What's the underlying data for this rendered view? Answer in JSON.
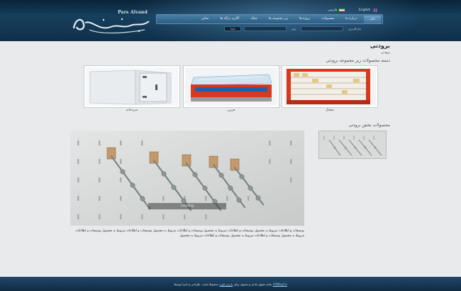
{
  "header": {
    "logo": {
      "latin_text": "Pars Alvand",
      "persian_text": "پارس الوند"
    },
    "languages": [
      {
        "label": "English",
        "flag": "uk-flag"
      },
      {
        "label": "فارسی",
        "flag": "iran-flag"
      }
    ],
    "nav": [
      {
        "label": "خانه"
      },
      {
        "label": "درباره ما"
      },
      {
        "label": "محصولات"
      },
      {
        "label": "پروژه ها"
      },
      {
        "label": "زیر مجموعه ها"
      },
      {
        "label": "مقاله"
      },
      {
        "label": "گالری درگاه ها"
      },
      {
        "label": "تماس"
      }
    ],
    "login": {
      "username_label": "نام کاربری",
      "password_label": "رمز",
      "button_label": "ورود"
    }
  },
  "main": {
    "page_title": "برودتی",
    "breadcrumb": "برودتی",
    "subcategories_heading": "دسته محصولات زیر مجموعه برودتی",
    "subcategories": [
      {
        "caption": "یخچال"
      },
      {
        "caption": "فریزر"
      },
      {
        "caption": "سردخانه"
      }
    ],
    "products_heading": "محصولات بخش برودتی",
    "loading_text": "Loading",
    "description": "توضیحات و اطلاعات مربوط به محصول توضیحات و اطلاعات مربوط به محصول توضیحات و اطلاعات مربوط به محصول توضیحات و اطلاعات مربوط به محصول توضیحات و اطلاعات مربوط به محصول توضیحات و اطلاعات مربوط به محصول توضیحات و اطلاعات مربوط به محصول"
  },
  "footer": {
    "text_before": "تمام حقوق مادی و معنوی برای",
    "company_link": "پارس الوند",
    "text_middle": "محفوظ است. طراحی و اجرا توسط",
    "designer_link": "AitWayCo"
  },
  "colors": {
    "header_dark": "#0a2438",
    "nav_blue": "#2c5b80",
    "page_bg": "#e9eaeb",
    "fridge_red": "#d63a1e"
  }
}
